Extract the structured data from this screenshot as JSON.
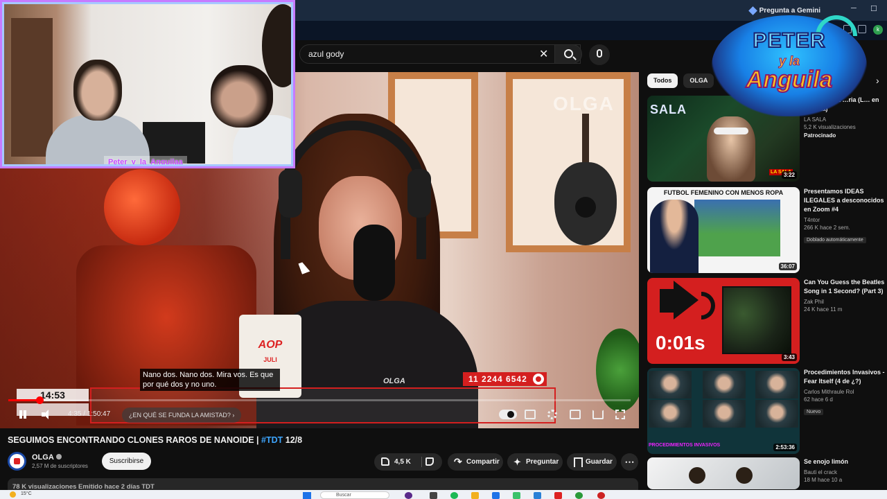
{
  "browser": {
    "gemini_label": "Pregunta a Gemini",
    "minimize": "─",
    "maximize": "☐",
    "close": "✕",
    "profile_initial": "k"
  },
  "search": {
    "value": "azul gody",
    "clear_icon": "✕"
  },
  "video": {
    "watermark": "OLGA",
    "phone_number": "11 2244 6542",
    "subtitle": "Nano dos. Nano dos. Mira vos. Es que por qué dos y no uno.",
    "mic_brand": "OLGA",
    "mug_logo": "AOP",
    "mug_name": "JULI",
    "overlay_clock": "14:53",
    "progress_fraction": 0.0506
  },
  "player": {
    "time": "4:35 / 1:50:47",
    "chapter": "¿EN QUÉ SE FUNDA LA AMISTAD? ›"
  },
  "video_info": {
    "title_main": "SEGUIMOS ENCONTRANDO CLONES RAROS DE NANOIDE | ",
    "title_hashtag": "#TDT",
    "title_suffix": " 12/8",
    "channel_name": "OLGA",
    "subscribers": "2,57 M de suscriptores",
    "subscribe_label": "Suscribirse",
    "likes": "4,5 K",
    "share_label": "Compartir",
    "ask_label": "Preguntar",
    "save_label": "Guardar",
    "more_label": "⋯",
    "description_line": "78 K visualizaciones  Emitido hace 2 días  TDT"
  },
  "chips": [
    "Todos",
    "OLGA"
  ],
  "related": [
    {
      "thumb_text": "SALA",
      "thumb_tag": "LA SALA",
      "duration": "3:22",
      "title": "…enta: Mala …ria (L… en La Sala)",
      "channel": "LA SALA",
      "meta": "5,2 K visualizaciones",
      "badge": "Patrocinado"
    },
    {
      "thumb_text": "FUTBOL FEMENINO CON MENOS ROPA",
      "duration": "36:07",
      "title": "Presentamos IDEAS ILEGALES a desconocidos en Zoom #4",
      "channel": "T4ntor",
      "meta": "266 K  hace 2 sem.",
      "badge": "Doblado automáticamente"
    },
    {
      "thumb_text": "0:01s",
      "duration": "3:43",
      "title": "Can You Guess the Beatles Song in 1 Second? (Part 3)",
      "channel": "Zak Phil",
      "meta": "24 K  hace 11 m"
    },
    {
      "thumb_tag": "PROCEDIMIENTOS INVASIVOS",
      "duration": "2:53:36",
      "title": "Procedimientos Invasivos - Fear Itself (4 de ¿?)",
      "channel": "Carlos Mithraule Rol",
      "meta": "62  hace 6 d",
      "badge": "Nuevo"
    },
    {
      "title": "Se enojo limón",
      "channel": "Bauti el crack",
      "meta": "18 M  hace 10 a"
    }
  ],
  "webcam": {
    "label": "Peter_y_la_Anguilaa"
  },
  "logo": {
    "line1": "PETER",
    "line2": "y la",
    "line3": "Anguila"
  },
  "taskbar": {
    "weather": "15°C",
    "search_placeholder": "Buscar"
  },
  "colors": {
    "accent_red": "#d41f1f",
    "link_blue": "#3ea6ff",
    "webcam_border": "#c77bff"
  }
}
